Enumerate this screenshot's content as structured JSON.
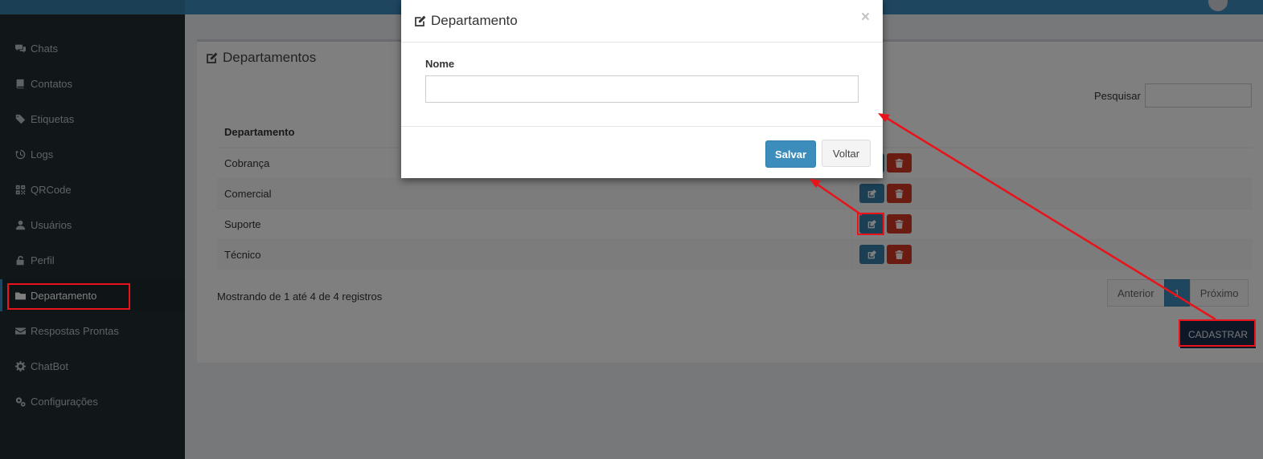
{
  "sidebar": {
    "items": [
      {
        "label": "Chats",
        "icon": "comments-icon"
      },
      {
        "label": "Contatos",
        "icon": "book-icon"
      },
      {
        "label": "Etiquetas",
        "icon": "tags-icon"
      },
      {
        "label": "Logs",
        "icon": "history-icon"
      },
      {
        "label": "QRCode",
        "icon": "qrcode-icon"
      },
      {
        "label": "Usuários",
        "icon": "user-icon"
      },
      {
        "label": "Perfil",
        "icon": "unlock-icon"
      },
      {
        "label": "Departamento",
        "icon": "folder-icon",
        "active": true
      },
      {
        "label": "Respostas Prontas",
        "icon": "envelope-icon"
      },
      {
        "label": "ChatBot",
        "icon": "gear-icon"
      },
      {
        "label": "Configurações",
        "icon": "gears-icon"
      }
    ]
  },
  "page": {
    "title": "Departamentos",
    "search_label": "Pesquisar",
    "table": {
      "header": "Departamento",
      "rows": [
        "Cobrança",
        "Comercial",
        "Suporte",
        "Técnico"
      ]
    },
    "info": "Mostrando de 1 até 4 de 4 registros",
    "pagination": {
      "prev": "Anterior",
      "current": "1",
      "next": "Próximo"
    },
    "create_button": "CADASTRAR"
  },
  "modal": {
    "title": "Departamento",
    "close": "×",
    "field_label": "Nome",
    "field_value": "",
    "save": "Salvar",
    "back": "Voltar"
  },
  "colors": {
    "primary": "#3c8dbc",
    "danger": "#d73925",
    "sidebar": "#222d32",
    "annotation": "#e8131b"
  }
}
